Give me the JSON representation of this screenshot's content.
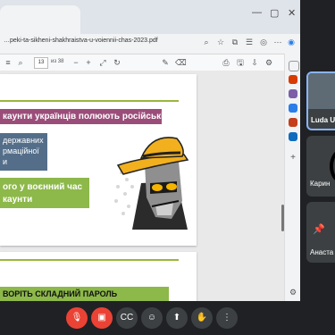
{
  "browser": {
    "url": "…peki-ta-sikheni-shakhraistva-u-voiennii-chas-2023.pdf",
    "page_current": "13",
    "page_total": "из 38",
    "window_controls": [
      "—",
      "▢",
      "✕"
    ]
  },
  "pdf": {
    "page1": {
      "title": "каунти українців полюють російські орки",
      "blue_box": "державних\nрмаційної\nи",
      "green_box": "ого у воєнний час\nкаунти"
    },
    "page2": {
      "title": "ВОРІТЬ СКЛАДНИЙ ПАРОЛЬ"
    }
  },
  "participants": [
    {
      "name": "Luda U"
    },
    {
      "name": "Карин"
    },
    {
      "name": "Анаста"
    }
  ],
  "controls": {
    "mic_icon": "mic-off-icon",
    "cam_icon": "camera-off-icon",
    "captions_icon": "captions-icon",
    "emoji_icon": "emoji-icon",
    "present_icon": "present-icon",
    "hand_icon": "raise-hand-icon",
    "more_icon": "more-icon",
    "end_icon": "end-call-icon"
  }
}
